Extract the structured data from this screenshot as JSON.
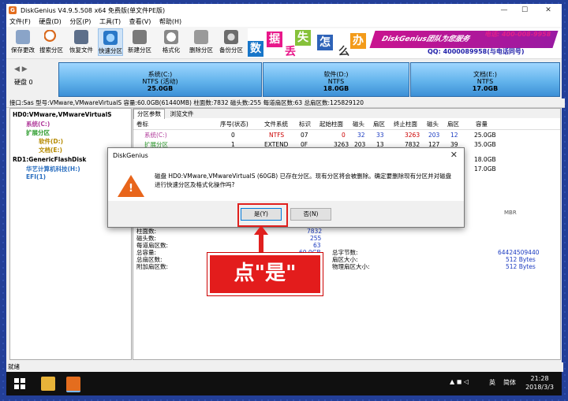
{
  "window": {
    "title": "DiskGenius V4.9.5.508 x64 免费版(单文件PE版)",
    "controls": {
      "minimize": "—",
      "maximize": "☐",
      "close": "✕"
    }
  },
  "menu": [
    "文件(F)",
    "硬盘(D)",
    "分区(P)",
    "工具(T)",
    "查看(V)",
    "帮助(H)"
  ],
  "toolbar": [
    "保存更改",
    "搜索分区",
    "恢复文件",
    "快速分区",
    "新建分区",
    "格式化",
    "删除分区",
    "备份分区"
  ],
  "banner": {
    "chars": [
      "数",
      "据",
      "丢",
      "失",
      "怎",
      "么",
      "办"
    ],
    "brand": "DiskGenius团队为您服务",
    "phone": "电话: 400-008-9958",
    "qq": "QQ: 4000089958(与电话同号)"
  },
  "disk": {
    "nav": "◀ ▶",
    "label": "硬盘 0",
    "partitions": [
      {
        "name": "系统(C:)",
        "fs": "NTFS (活动)",
        "size": "25.0GB"
      },
      {
        "name": "软件(D:)",
        "fs": "NTFS",
        "size": "18.0GB"
      },
      {
        "name": "文档(E:)",
        "fs": "NTFS",
        "size": "17.0GB"
      }
    ],
    "info": "接口:Sas  型号:VMware,VMwareVirtualS  容量:60.0GB(61440MB)  柱面数:7832  磁头数:255  每道扇区数:63  总扇区数:125829120"
  },
  "tree": [
    "HD0:VMware,VMwareVirtualS",
    "系统(C:)",
    "扩展分区",
    "软件(D:)",
    "文档(E:)",
    "RD1:GenericFlashDisk",
    "华艺计算机科技(H:)",
    "EFI(1)"
  ],
  "tabs": [
    "分区参数",
    "浏览文件"
  ],
  "table": {
    "headers": [
      "卷标",
      "序号(状态)",
      "文件系统",
      "标识",
      "起始柱面",
      "磁头",
      "扇区",
      "终止柱面",
      "磁头",
      "扇区",
      "容量"
    ],
    "rows": [
      [
        "系统(C:)",
        "0",
        "NTFS",
        "07",
        "0",
        "32",
        "33",
        "3263",
        "203",
        "12",
        "25.0GB"
      ],
      [
        "扩展分区",
        "1",
        "EXTEND",
        "0F",
        "3263",
        "203",
        "13",
        "7832",
        "127",
        "39",
        "35.0GB"
      ],
      [
        "",
        "",
        "",
        "",
        "",
        "",
        "",
        "",
        "",
        "",
        "18.0GB"
      ],
      [
        "",
        "",
        "",
        "",
        "",
        "",
        "",
        "",
        "",
        "",
        "17.0GB"
      ]
    ]
  },
  "details": {
    "mbr": "MBR",
    "rows": [
      [
        "柱面数:",
        "7832",
        "",
        ""
      ],
      [
        "磁头数:",
        "255",
        "",
        ""
      ],
      [
        "每道扇区数:",
        "63",
        "",
        ""
      ],
      [
        "总容量:",
        "60.0GB",
        "总字节数:",
        "64424509440"
      ],
      [
        "总扇区数:",
        "125829120",
        "扇区大小:",
        "512 Bytes"
      ],
      [
        "附加扇区数:",
        "8040",
        "物理扇区大小:",
        "512 Bytes"
      ]
    ]
  },
  "dialog": {
    "title": "DiskGenius",
    "message": "磁盘 HD0:VMware,VMwareVirtualS (60GB) 已存在分区。现有分区将会被删除。确定要删除现有分区并对磁盘进行快速分区及格式化操作吗?",
    "yes": "是(Y)",
    "no": "否(N)"
  },
  "callout": "点\"是\"",
  "status": "就绪",
  "taskbar": {
    "ime": "英",
    "lang": "简体",
    "time": "21:28",
    "date": "2018/3/3"
  }
}
